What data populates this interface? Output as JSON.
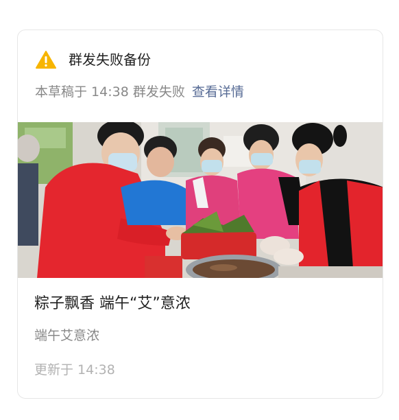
{
  "alert": {
    "icon": "warning-triangle-icon",
    "icon_color": "#f7b500",
    "title": "群发失败备份"
  },
  "status": {
    "draft_text": "本草稿于 14:38 群发失败",
    "detail_link": "查看详情",
    "link_color": "#576b95"
  },
  "article": {
    "cover_image": "volunteers-making-zongzi-photo",
    "title": "粽子飘香 端午“艾”意浓",
    "digest": "端午艾意浓",
    "updated": "更新于 14:38"
  }
}
